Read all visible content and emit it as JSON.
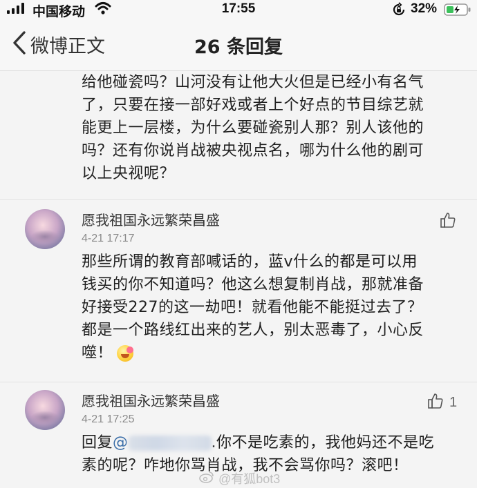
{
  "status_bar": {
    "carrier": "中国移动",
    "time": "17:55",
    "battery_percent": "32%"
  },
  "nav": {
    "back_label": "微博正文",
    "title": "26 条回复"
  },
  "top_comment": {
    "lines": [
      "给他碰瓷吗？山河没有让他大火但是已经小有名气",
      "了，只要在接一部好戏或者上个好点的节目综艺就",
      "能更上一层楼，为什么要碰瓷别人那？别人该他的",
      "吗？还有你说肖战被央视点名，哪为什么他的剧可",
      "以上央视呢？"
    ]
  },
  "comments": [
    {
      "username": "愿我祖国永远繁荣昌盛",
      "timestamp": "4-21 17:17",
      "like_count": "",
      "lines": [
        "那些所谓的教育部喊话的，蓝v什么的都是可以用",
        "钱买的你不知道吗？他这么想复制肖战，那就准备",
        "好接受227的这一劫吧！就看他能不能挺过去了？",
        "都是一个路线红出来的艺人，别太恶毒了，小心反",
        "噬！"
      ]
    },
    {
      "username": "愿我祖国永远繁荣昌盛",
      "timestamp": "4-21 17:25",
      "like_count": "1",
      "reply_prefix": "回复",
      "mention_at": "@",
      "line1_rest": ".你不是吃素的，我他妈还不是吃",
      "line2": "素的呢？咋地你骂肖战，我不会骂你吗？滚吧！"
    }
  ],
  "watermark": "@有狐bot3",
  "colors": {
    "background": "#f4f4f4",
    "text": "#1f1f1f",
    "timestamp": "#8a8a8a",
    "mention": "#3b6ea8"
  },
  "icons": [
    "signal-icon",
    "wifi-icon",
    "rotation-lock-icon",
    "battery-icon",
    "back-chevron-icon",
    "like-icon",
    "emoji-icon"
  ]
}
